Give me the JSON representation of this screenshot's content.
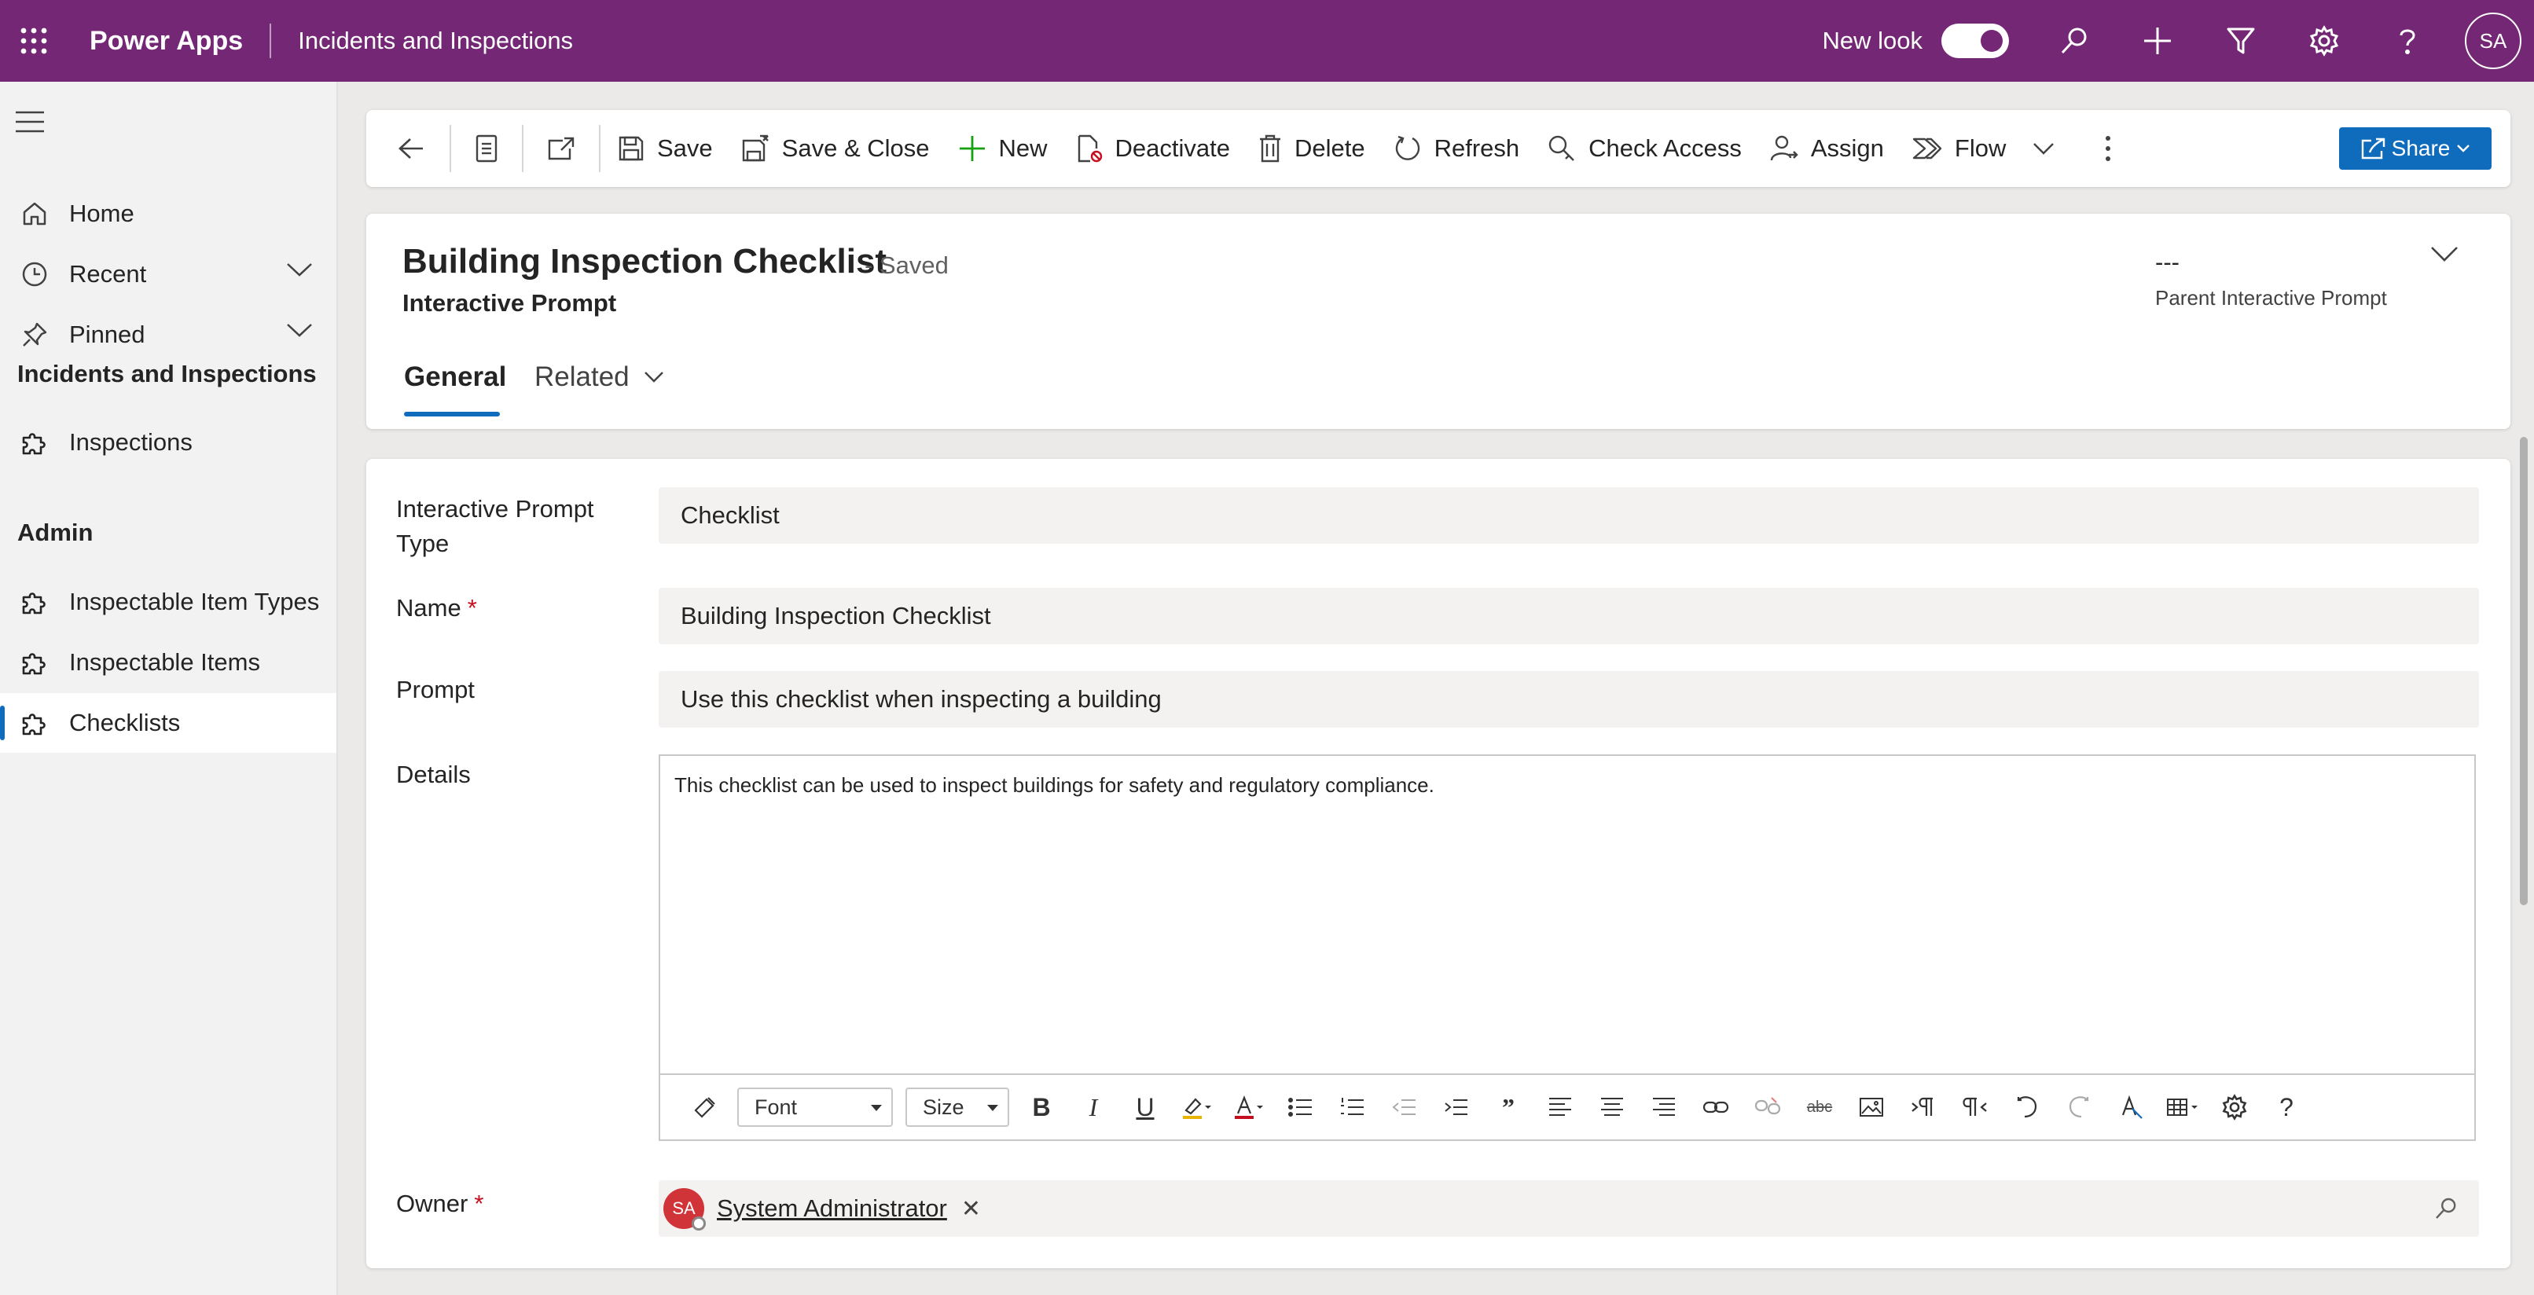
{
  "topbar": {
    "app_name": "Power Apps",
    "environment": "Incidents and Inspections",
    "new_look_label": "New look",
    "new_look_on": true,
    "user_initials": "SA",
    "brand_color": "#742774"
  },
  "sidebar": {
    "home": "Home",
    "recent": "Recent",
    "pinned": "Pinned",
    "section_app": "Incidents and Inspections",
    "inspections": "Inspections",
    "section_admin": "Admin",
    "inspectable_item_types": "Inspectable Item Types",
    "inspectable_items": "Inspectable Items",
    "checklists": "Checklists",
    "active_item": "Checklists"
  },
  "commandbar": {
    "save": "Save",
    "save_close": "Save & Close",
    "new": "New",
    "deactivate": "Deactivate",
    "delete": "Delete",
    "refresh": "Refresh",
    "check_access": "Check Access",
    "assign": "Assign",
    "flow": "Flow",
    "share": "Share",
    "accent_color": "#0f6cbd"
  },
  "record": {
    "title": "Building Inspection Checklist",
    "status": "- Saved",
    "entity": "Interactive Prompt",
    "header_field_value": "---",
    "header_field_label": "Parent Interactive Prompt",
    "tabs": [
      "General",
      "Related"
    ],
    "selected_tab": "General"
  },
  "form": {
    "type_label": "Interactive Prompt Type",
    "type_value": "Checklist",
    "name_label": "Name",
    "name_value": "Building Inspection Checklist",
    "prompt_label": "Prompt",
    "prompt_value": "Use this checklist when inspecting a building",
    "details_label": "Details",
    "details_value": "This checklist can be used to inspect buildings for safety and regulatory compliance.",
    "editor_font": "Font",
    "editor_size": "Size",
    "owner_label": "Owner",
    "owner_value": "System Administrator",
    "owner_initials": "SA",
    "required_mark": "*"
  }
}
